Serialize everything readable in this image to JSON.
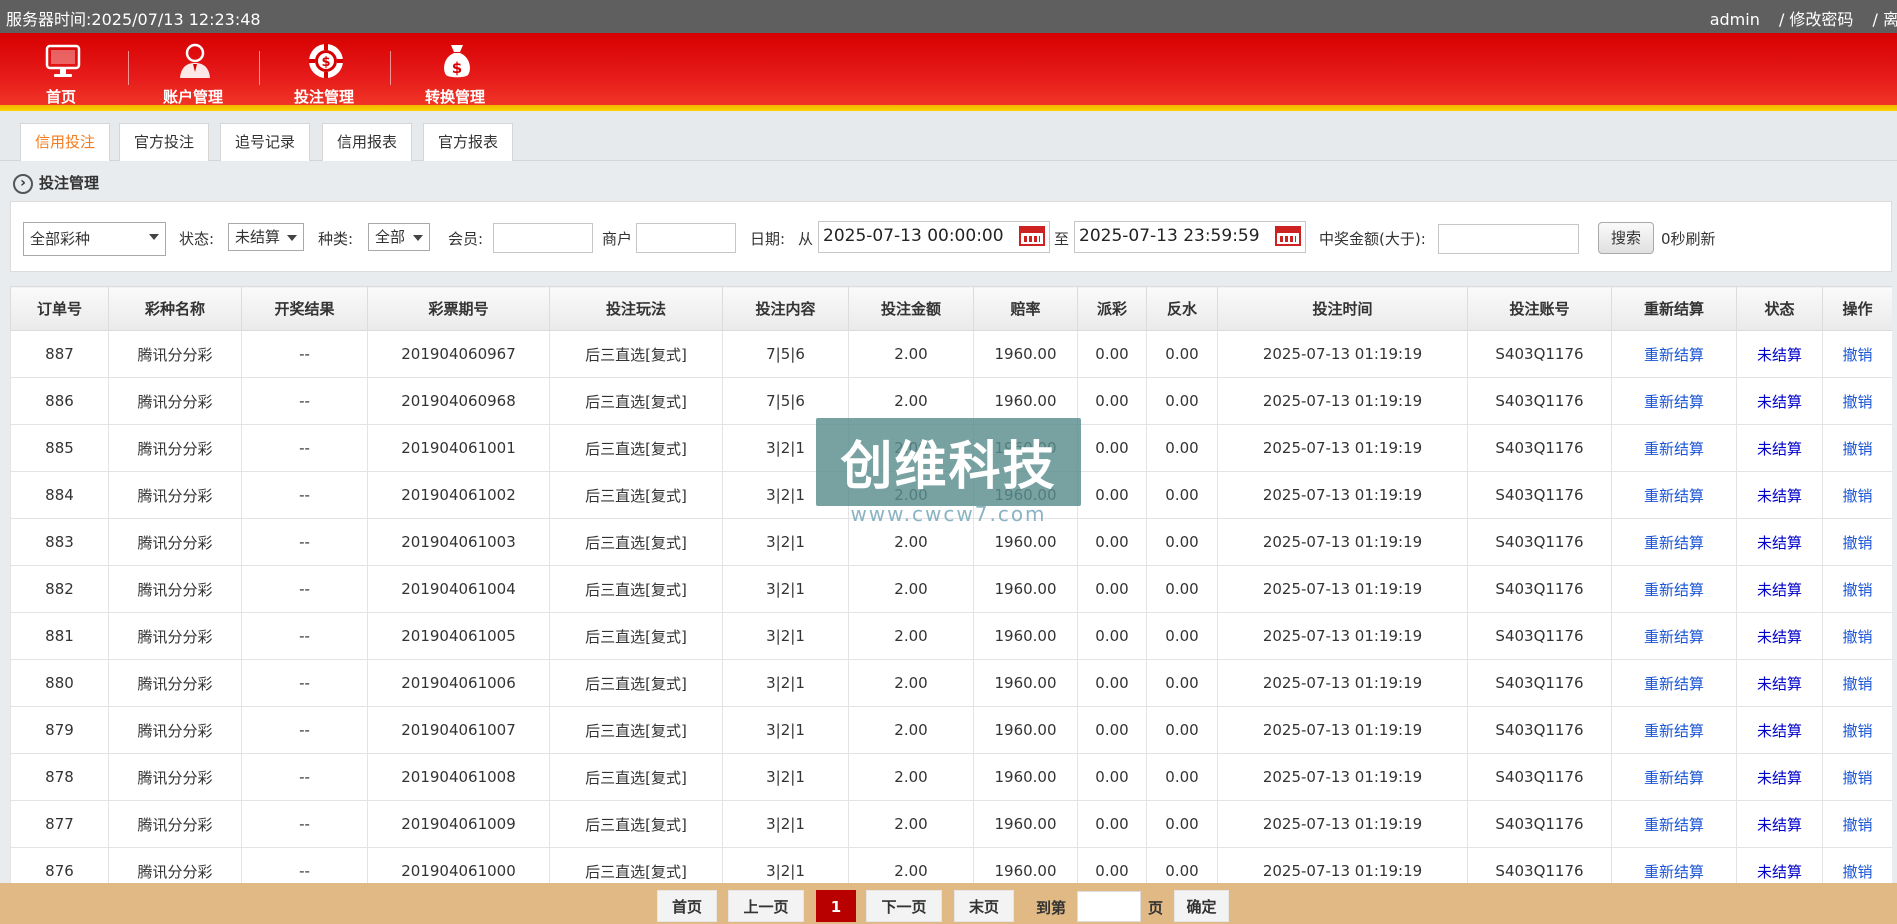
{
  "topbar": {
    "server_time_label": "服务器时间:",
    "server_time": "2025/07/13 12:23:48",
    "user": "admin",
    "change_password": "/ 修改密码",
    "logout": "/ 离开"
  },
  "nav": [
    {
      "label": "首页",
      "icon": "monitor-icon"
    },
    {
      "label": "账户管理",
      "icon": "user-icon"
    },
    {
      "label": "投注管理",
      "icon": "casino-chip-icon",
      "active": true
    },
    {
      "label": "转换管理",
      "icon": "money-bag-icon"
    }
  ],
  "subtabs": [
    "信用投注",
    "官方投注",
    "追号记录",
    "信用报表",
    "官方报表"
  ],
  "section_title": "投注管理",
  "filters": {
    "lottery_select": "全部彩种",
    "status_label": "状态:",
    "status_value": "未结算",
    "type_label": "种类:",
    "type_value": "全部",
    "member_label": "会员:",
    "member_value": "",
    "merchant_label": "商户",
    "merchant_value": "",
    "date_label": "日期:",
    "from_label": "从",
    "date_from": "2025-07-13 00:00:00",
    "to_label": "至",
    "date_to": "2025-07-13 23:59:59",
    "win_amount_label": "中奖金额(大于):",
    "win_amount_value": "",
    "search_button": "搜索",
    "refresh_text": "0秒刷新"
  },
  "table": {
    "headers": [
      "订单号",
      "彩种名称",
      "开奖结果",
      "彩票期号",
      "投注玩法",
      "投注内容",
      "投注金额",
      "赔率",
      "派彩",
      "反水",
      "投注时间",
      "投注账号",
      "重新结算",
      "状态",
      "操作"
    ],
    "rows": [
      [
        "887",
        "腾讯分分彩",
        "--",
        "201904060967",
        "后三直选[复式]",
        "7|5|6",
        "2.00",
        "1960.00",
        "0.00",
        "0.00",
        "2025-07-13 01:19:19",
        "S403Q1176",
        "重新结算",
        "未结算",
        "撤销"
      ],
      [
        "886",
        "腾讯分分彩",
        "--",
        "201904060968",
        "后三直选[复式]",
        "7|5|6",
        "2.00",
        "1960.00",
        "0.00",
        "0.00",
        "2025-07-13 01:19:19",
        "S403Q1176",
        "重新结算",
        "未结算",
        "撤销"
      ],
      [
        "885",
        "腾讯分分彩",
        "--",
        "201904061001",
        "后三直选[复式]",
        "3|2|1",
        "2.00",
        "1960.00",
        "0.00",
        "0.00",
        "2025-07-13 01:19:19",
        "S403Q1176",
        "重新结算",
        "未结算",
        "撤销"
      ],
      [
        "884",
        "腾讯分分彩",
        "--",
        "201904061002",
        "后三直选[复式]",
        "3|2|1",
        "2.00",
        "1960.00",
        "0.00",
        "0.00",
        "2025-07-13 01:19:19",
        "S403Q1176",
        "重新结算",
        "未结算",
        "撤销"
      ],
      [
        "883",
        "腾讯分分彩",
        "--",
        "201904061003",
        "后三直选[复式]",
        "3|2|1",
        "2.00",
        "1960.00",
        "0.00",
        "0.00",
        "2025-07-13 01:19:19",
        "S403Q1176",
        "重新结算",
        "未结算",
        "撤销"
      ],
      [
        "882",
        "腾讯分分彩",
        "--",
        "201904061004",
        "后三直选[复式]",
        "3|2|1",
        "2.00",
        "1960.00",
        "0.00",
        "0.00",
        "2025-07-13 01:19:19",
        "S403Q1176",
        "重新结算",
        "未结算",
        "撤销"
      ],
      [
        "881",
        "腾讯分分彩",
        "--",
        "201904061005",
        "后三直选[复式]",
        "3|2|1",
        "2.00",
        "1960.00",
        "0.00",
        "0.00",
        "2025-07-13 01:19:19",
        "S403Q1176",
        "重新结算",
        "未结算",
        "撤销"
      ],
      [
        "880",
        "腾讯分分彩",
        "--",
        "201904061006",
        "后三直选[复式]",
        "3|2|1",
        "2.00",
        "1960.00",
        "0.00",
        "0.00",
        "2025-07-13 01:19:19",
        "S403Q1176",
        "重新结算",
        "未结算",
        "撤销"
      ],
      [
        "879",
        "腾讯分分彩",
        "--",
        "201904061007",
        "后三直选[复式]",
        "3|2|1",
        "2.00",
        "1960.00",
        "0.00",
        "0.00",
        "2025-07-13 01:19:19",
        "S403Q1176",
        "重新结算",
        "未结算",
        "撤销"
      ],
      [
        "878",
        "腾讯分分彩",
        "--",
        "201904061008",
        "后三直选[复式]",
        "3|2|1",
        "2.00",
        "1960.00",
        "0.00",
        "0.00",
        "2025-07-13 01:19:19",
        "S403Q1176",
        "重新结算",
        "未结算",
        "撤销"
      ],
      [
        "877",
        "腾讯分分彩",
        "--",
        "201904061009",
        "后三直选[复式]",
        "3|2|1",
        "2.00",
        "1960.00",
        "0.00",
        "0.00",
        "2025-07-13 01:19:19",
        "S403Q1176",
        "重新结算",
        "未结算",
        "撤销"
      ],
      [
        "876",
        "腾讯分分彩",
        "--",
        "201904061000",
        "后三直选[复式]",
        "3|2|1",
        "2.00",
        "1960.00",
        "0.00",
        "0.00",
        "2025-07-13 01:19:19",
        "S403Q1176",
        "重新结算",
        "未结算",
        "撤销"
      ]
    ]
  },
  "watermark": {
    "title": "创维科技",
    "url": "www.cwcw7.com"
  },
  "pager": {
    "first": "首页",
    "prev": "上一页",
    "current": "1",
    "next": "下一页",
    "last": "末页",
    "goto_label": "到第",
    "page_unit": "页",
    "confirm": "确定"
  },
  "colors": {
    "brand_red": "#d70000",
    "accent_yellow": "#f8d600",
    "link_blue": "#1a55d6",
    "active_tab": "#f37b1d",
    "pager_bg": "#e0b985"
  }
}
